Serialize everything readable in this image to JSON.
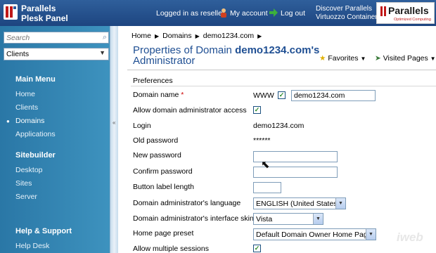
{
  "top_bar": {
    "brand_line1": "Parallels",
    "brand_line2": "Plesk Panel",
    "logged_in": "Logged in as reseller",
    "my_account": "My account",
    "log_out": "Log out",
    "discover_line1": "Discover Parallels",
    "discover_line2": "Virtuozzo Containers",
    "logo_text": "Parallels",
    "logo_sub": "Optimized Computing"
  },
  "sidebar": {
    "search_placeholder": "Search",
    "clients_select": "Clients",
    "main_menu": "Main Menu",
    "main_items": [
      "Home",
      "Clients",
      "Domains",
      "Applications"
    ],
    "sitebuilder": "Sitebuilder",
    "sitebuilder_items": [
      "Desktop",
      "Sites",
      "Server"
    ],
    "help": "Help & Support",
    "help_items": [
      "Help Desk"
    ]
  },
  "main": {
    "breadcrumb": [
      "Home",
      "Domains",
      "demo1234.com"
    ],
    "title_prefix": "Properties of Domain",
    "title_domain": "demo1234.com's",
    "title_line2": "Administrator",
    "favorites": "Favorites",
    "visited_pages": "Visited Pages",
    "preferences_label": "Preferences",
    "form": {
      "domain_name_label": "Domain name",
      "www_label": "WWW",
      "domain_name_value": "demo1234.com",
      "allow_access_label": "Allow domain administrator access",
      "login_label": "Login",
      "login_value": "demo1234.com",
      "old_password_label": "Old password",
      "old_password_value": "******",
      "new_password_label": "New password",
      "confirm_password_label": "Confirm password",
      "button_label_length_label": "Button label length",
      "language_label": "Domain administrator's language",
      "language_value": "ENGLISH (United States)",
      "skin_label": "Domain administrator's interface skin",
      "skin_value": "Vista",
      "home_preset_label": "Home page preset",
      "home_preset_value": "Default Domain Owner Home Page",
      "multiple_sessions_label": "Allow multiple sessions"
    }
  },
  "watermark": "iweb"
}
